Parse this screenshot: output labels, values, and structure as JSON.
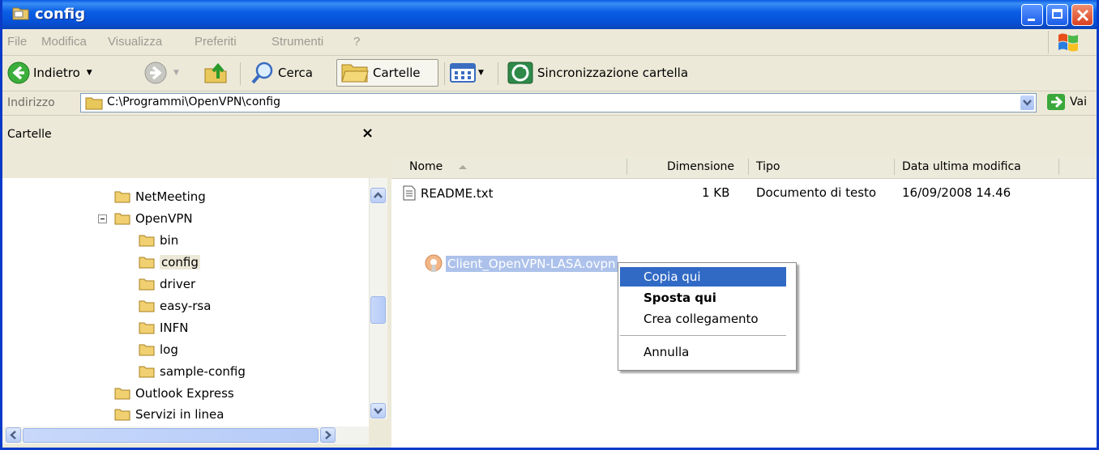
{
  "window": {
    "title": "config"
  },
  "menu": [
    "File",
    "Modifica",
    "Visualizza",
    "Preferiti",
    "Strumenti",
    "?"
  ],
  "toolbar": {
    "back": "Indietro",
    "search": "Cerca",
    "folders": "Cartelle",
    "sync": "Sincronizzazione cartella"
  },
  "address": {
    "label": "Indirizzo",
    "path": "C:\\Programmi\\OpenVPN\\config",
    "go": "Vai"
  },
  "folders_pane": {
    "title": "Cartelle",
    "close": "×",
    "tree": [
      {
        "label": "NetMeeting"
      },
      {
        "label": "OpenVPN"
      },
      {
        "label": "bin"
      },
      {
        "label": "config",
        "selected": true
      },
      {
        "label": "driver"
      },
      {
        "label": "easy-rsa"
      },
      {
        "label": "INFN"
      },
      {
        "label": "log"
      },
      {
        "label": "sample-config"
      },
      {
        "label": "Outlook Express"
      },
      {
        "label": "Servizi in linea"
      }
    ]
  },
  "list": {
    "columns": [
      "Nome",
      "Dimensione",
      "Tipo",
      "Data ultima modifica"
    ],
    "rows": [
      {
        "name": "README.txt",
        "size": "1 KB",
        "type": "Documento di testo",
        "modified": "16/09/2008 14.46"
      }
    ],
    "dragged": "Client_OpenVPN-LASA.ovpn"
  },
  "context_menu": {
    "items": [
      "Copia qui",
      "Sposta qui",
      "Crea collegamento",
      "Annulla"
    ],
    "highlighted": "Copia qui",
    "default": "Sposta qui"
  },
  "colors": {
    "titlebar": "#0a5fe4",
    "menu_highlight": "#316ac5",
    "chrome": "#ece9d8"
  }
}
